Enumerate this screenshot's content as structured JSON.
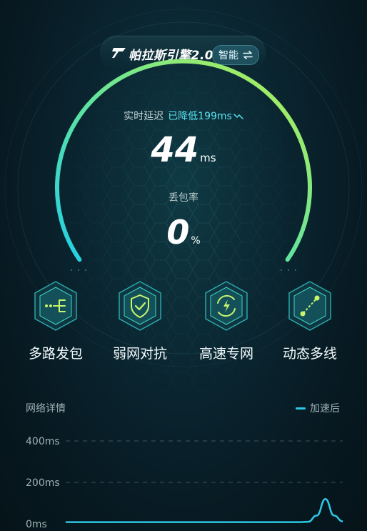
{
  "engine": {
    "title": "帕拉斯引擎2.0",
    "mode_label": "智能",
    "mode_icon": "swap-arrows-icon"
  },
  "gauge": {
    "latency_label": "实时延迟",
    "latency_reduced_text": "已降低199ms",
    "latency_value": "44",
    "latency_unit": "ms",
    "loss_label": "丢包率",
    "loss_value": "0",
    "loss_unit": "%",
    "colors": {
      "arc_start": "#23d3e8",
      "arc_end": "#b8f050"
    }
  },
  "features": [
    {
      "label": "多路发包",
      "icon": "multipath-icon"
    },
    {
      "label": "弱网对抗",
      "icon": "shield-check-icon"
    },
    {
      "label": "高速专网",
      "icon": "lightning-cycle-icon"
    },
    {
      "label": "动态多线",
      "icon": "dynamic-link-icon"
    }
  ],
  "details": {
    "title": "网络详情",
    "legend_label": "加速后"
  },
  "chart_data": {
    "type": "line",
    "ylabel": "",
    "xlabel": "",
    "y_ticks": [
      "400ms",
      "200ms",
      "0ms"
    ],
    "ylim": [
      0,
      400
    ],
    "series": [
      {
        "name": "加速后",
        "values": [
          8,
          8,
          8,
          8,
          8,
          8,
          8,
          8,
          8,
          8,
          8,
          8,
          8,
          8,
          8,
          8,
          8,
          8,
          8,
          8,
          8,
          8,
          8,
          8,
          8,
          8,
          8,
          8,
          10,
          40,
          120,
          40,
          12
        ]
      }
    ],
    "grid": true
  }
}
